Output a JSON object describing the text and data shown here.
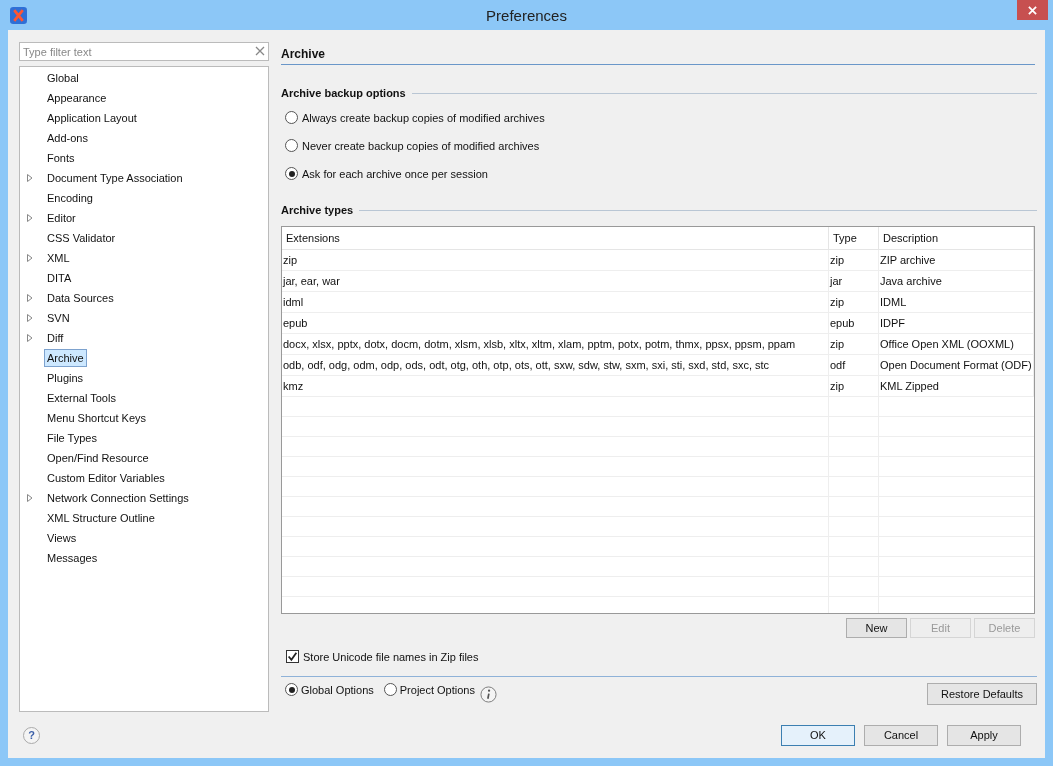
{
  "window": {
    "title": "Preferences"
  },
  "filter": {
    "placeholder": "Type filter text"
  },
  "tree": [
    {
      "label": "Global",
      "expandable": false,
      "selected": false
    },
    {
      "label": "Appearance",
      "expandable": false,
      "selected": false
    },
    {
      "label": "Application Layout",
      "expandable": false,
      "selected": false
    },
    {
      "label": "Add-ons",
      "expandable": false,
      "selected": false
    },
    {
      "label": "Fonts",
      "expandable": false,
      "selected": false
    },
    {
      "label": "Document Type Association",
      "expandable": true,
      "selected": false
    },
    {
      "label": "Encoding",
      "expandable": false,
      "selected": false
    },
    {
      "label": "Editor",
      "expandable": true,
      "selected": false
    },
    {
      "label": "CSS Validator",
      "expandable": false,
      "selected": false
    },
    {
      "label": "XML",
      "expandable": true,
      "selected": false
    },
    {
      "label": "DITA",
      "expandable": false,
      "selected": false
    },
    {
      "label": "Data Sources",
      "expandable": true,
      "selected": false
    },
    {
      "label": "SVN",
      "expandable": true,
      "selected": false
    },
    {
      "label": "Diff",
      "expandable": true,
      "selected": false
    },
    {
      "label": "Archive",
      "expandable": false,
      "selected": true
    },
    {
      "label": "Plugins",
      "expandable": false,
      "selected": false
    },
    {
      "label": "External Tools",
      "expandable": false,
      "selected": false
    },
    {
      "label": "Menu Shortcut Keys",
      "expandable": false,
      "selected": false
    },
    {
      "label": "File Types",
      "expandable": false,
      "selected": false
    },
    {
      "label": "Open/Find Resource",
      "expandable": false,
      "selected": false
    },
    {
      "label": "Custom Editor Variables",
      "expandable": false,
      "selected": false
    },
    {
      "label": "Network Connection Settings",
      "expandable": true,
      "selected": false
    },
    {
      "label": "XML Structure Outline",
      "expandable": false,
      "selected": false
    },
    {
      "label": "Views",
      "expandable": false,
      "selected": false
    },
    {
      "label": "Messages",
      "expandable": false,
      "selected": false
    }
  ],
  "page_title": "Archive",
  "backup": {
    "heading": "Archive backup options",
    "options": [
      {
        "label": "Always create backup copies of modified archives",
        "selected": false
      },
      {
        "label": "Never create backup copies of modified archives",
        "selected": false
      },
      {
        "label": "Ask for each archive once per session",
        "selected": true
      }
    ]
  },
  "types": {
    "heading": "Archive types",
    "columns": [
      "Extensions",
      "Type",
      "Description"
    ],
    "rows": [
      [
        "zip",
        "zip",
        "ZIP archive"
      ],
      [
        "jar, ear, war",
        "jar",
        "Java archive"
      ],
      [
        "idml",
        "zip",
        "IDML"
      ],
      [
        "epub",
        "epub",
        "IDPF"
      ],
      [
        "docx, xlsx, pptx, dotx, docm, dotm, xlsm, xlsb, xltx, xltm, xlam, pptm, potx, potm, thmx, ppsx, ppsm, ppam",
        "zip",
        "Office Open XML (OOXML)"
      ],
      [
        "odb, odf, odg, odm, odp, ods, odt, otg, oth, otp, ots, ott, sxw, sdw, stw, sxm, sxi, sti, sxd, std, sxc, stc",
        "odf",
        "Open Document Format (ODF)"
      ],
      [
        "kmz",
        "zip",
        "KML Zipped"
      ]
    ],
    "buttons": [
      {
        "label": "New",
        "disabled": false
      },
      {
        "label": "Edit",
        "disabled": true
      },
      {
        "label": "Delete",
        "disabled": true
      }
    ]
  },
  "unicode": {
    "label": "Store Unicode file names in Zip files",
    "checked": true
  },
  "scope": [
    {
      "label": "Global Options",
      "selected": true
    },
    {
      "label": "Project Options",
      "selected": false
    }
  ],
  "restore": "Restore Defaults",
  "help": "?",
  "dialog_buttons": [
    {
      "label": "OK",
      "default": true
    },
    {
      "label": "Cancel",
      "default": false
    },
    {
      "label": "Apply",
      "default": false
    }
  ]
}
